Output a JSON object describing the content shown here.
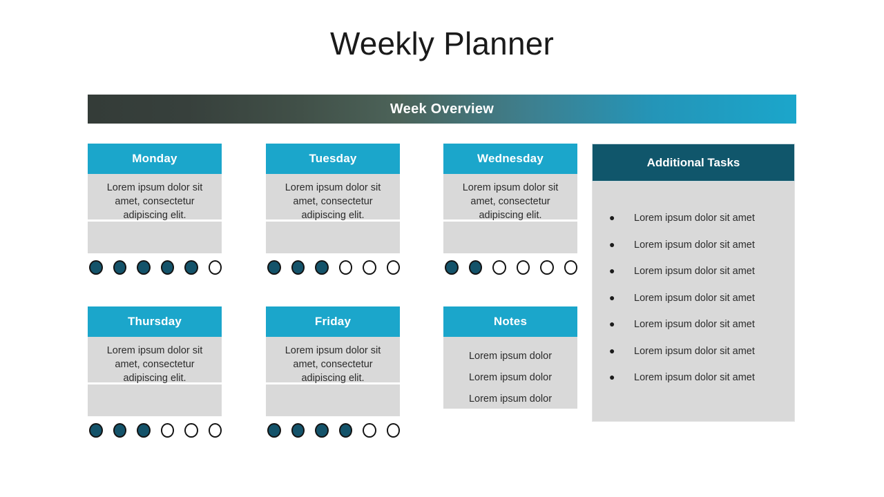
{
  "title": "Weekly Planner",
  "banner": {
    "label": "Week Overview",
    "gradient_start": "#343c38",
    "gradient_end": "#1ba6cb"
  },
  "colors": {
    "accent_cyan": "#1ba6cb",
    "accent_dark_teal": "#10566b",
    "dot_filled": "#14536a",
    "panel_grey": "#d9d9d9",
    "text": "#2b2b2b"
  },
  "days": [
    {
      "name": "Monday",
      "body": "Lorem ipsum dolor sit amet, consectetur adipiscing elit.",
      "dots_total": 6,
      "dots_filled": 5
    },
    {
      "name": "Tuesday",
      "body": "Lorem ipsum dolor sit amet, consectetur adipiscing elit.",
      "dots_total": 6,
      "dots_filled": 3
    },
    {
      "name": "Wednesday",
      "body": "Lorem ipsum dolor sit amet, consectetur adipiscing elit.",
      "dots_total": 6,
      "dots_filled": 2
    },
    {
      "name": "Thursday",
      "body": "Lorem ipsum dolor sit amet, consectetur adipiscing elit.",
      "dots_total": 6,
      "dots_filled": 3
    },
    {
      "name": "Friday",
      "body": "Lorem ipsum dolor sit amet, consectetur adipiscing elit.",
      "dots_total": 6,
      "dots_filled": 4
    }
  ],
  "notes": {
    "header": "Notes",
    "lines": [
      "Lorem ipsum dolor",
      "Lorem ipsum dolor",
      "Lorem ipsum dolor"
    ]
  },
  "additional_tasks": {
    "header": "Additional Tasks",
    "bullet_glyph": "●",
    "items": [
      "Lorem ipsum dolor sit amet",
      "Lorem ipsum dolor sit amet",
      "Lorem ipsum dolor sit amet",
      "Lorem ipsum dolor sit amet",
      "Lorem ipsum dolor sit amet",
      "Lorem ipsum dolor sit amet",
      "Lorem ipsum dolor sit amet"
    ]
  }
}
